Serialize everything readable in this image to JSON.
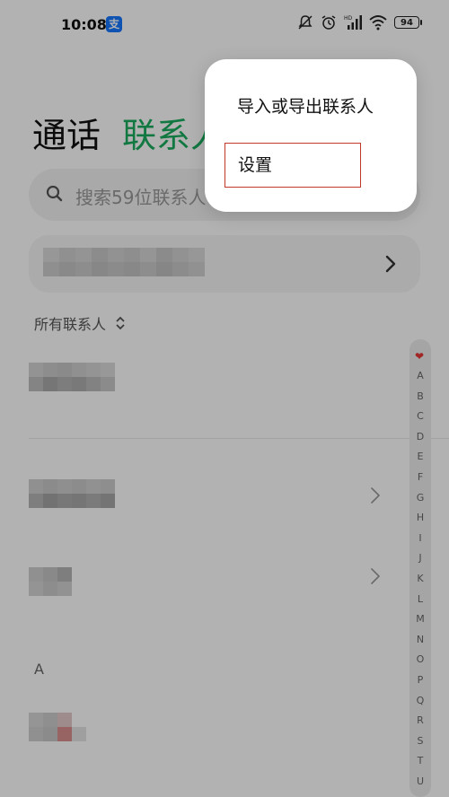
{
  "status_bar": {
    "time": "10:08",
    "app_icon_glyph": "支",
    "icons": [
      "mute-icon",
      "alarm-icon",
      "hd-signal-icon",
      "wifi-icon"
    ],
    "battery": "94"
  },
  "header": {
    "tab_calls": "通话",
    "tab_contacts": "联系人"
  },
  "search": {
    "placeholder": "搜索59位联系人"
  },
  "filter": {
    "label": "所有联系人"
  },
  "section": {
    "letter": "A"
  },
  "alphabet_index": {
    "favorite_icon": "heart-icon",
    "letters": [
      "A",
      "B",
      "C",
      "D",
      "E",
      "F",
      "G",
      "H",
      "I",
      "J",
      "K",
      "L",
      "M",
      "N",
      "O",
      "P",
      "Q",
      "R",
      "S",
      "T",
      "U"
    ]
  },
  "popup_menu": {
    "items": [
      "导入或导出联系人",
      "设置"
    ]
  },
  "colors": {
    "accent": "#1aad5d",
    "highlight_border": "#c0392b",
    "favorite": "#e53935"
  }
}
